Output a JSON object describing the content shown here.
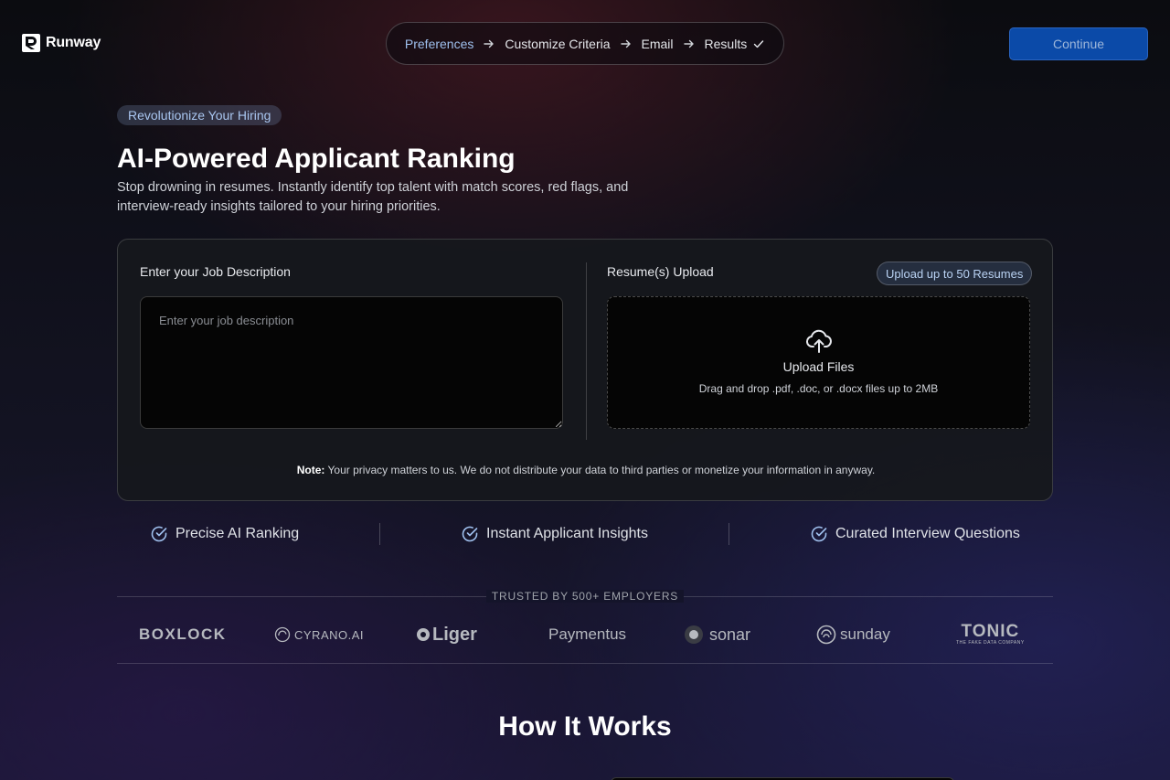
{
  "header": {
    "brand": "Runway",
    "steps": [
      {
        "label": "Preferences",
        "active": true
      },
      {
        "label": "Customize Criteria",
        "active": false
      },
      {
        "label": "Email",
        "active": false
      },
      {
        "label": "Results",
        "active": false
      }
    ],
    "continue_label": "Continue"
  },
  "hero": {
    "badge": "Revolutionize Your Hiring",
    "title": "AI-Powered Applicant Ranking",
    "subtitle": "Stop drowning in resumes. Instantly identify top talent with match scores, red flags, and interview-ready insights tailored to your hiring priorities."
  },
  "form": {
    "jd_label": "Enter your Job Description",
    "jd_placeholder": "Enter your job description",
    "jd_value": "",
    "upload_label": "Resume(s) Upload",
    "upload_limit": "Upload up to 50 Resumes",
    "upload_title": "Upload Files",
    "upload_hint": "Drag and drop .pdf, .doc, or .docx files up to 2MB",
    "note_bold": "Note:",
    "note_text": " Your privacy matters to us. We do not distribute your data to third parties or monetize your information in anyway."
  },
  "features": [
    "Precise AI Ranking",
    "Instant Applicant Insights",
    "Curated Interview Questions"
  ],
  "trusted": {
    "label": "TRUSTED BY 500+ EMPLOYERS",
    "brands": [
      "BOXLOCK",
      "CYRANO.AI",
      "Liger",
      "Paymentus",
      "sonar",
      "sunday",
      "TONIC",
      "THE FAKE DATA COMPANY"
    ]
  },
  "how_it_works": "How It Works",
  "colors": {
    "accent": "#0b4aa8",
    "active_step": "#9fc0ee",
    "check": "#9fc0ee"
  }
}
